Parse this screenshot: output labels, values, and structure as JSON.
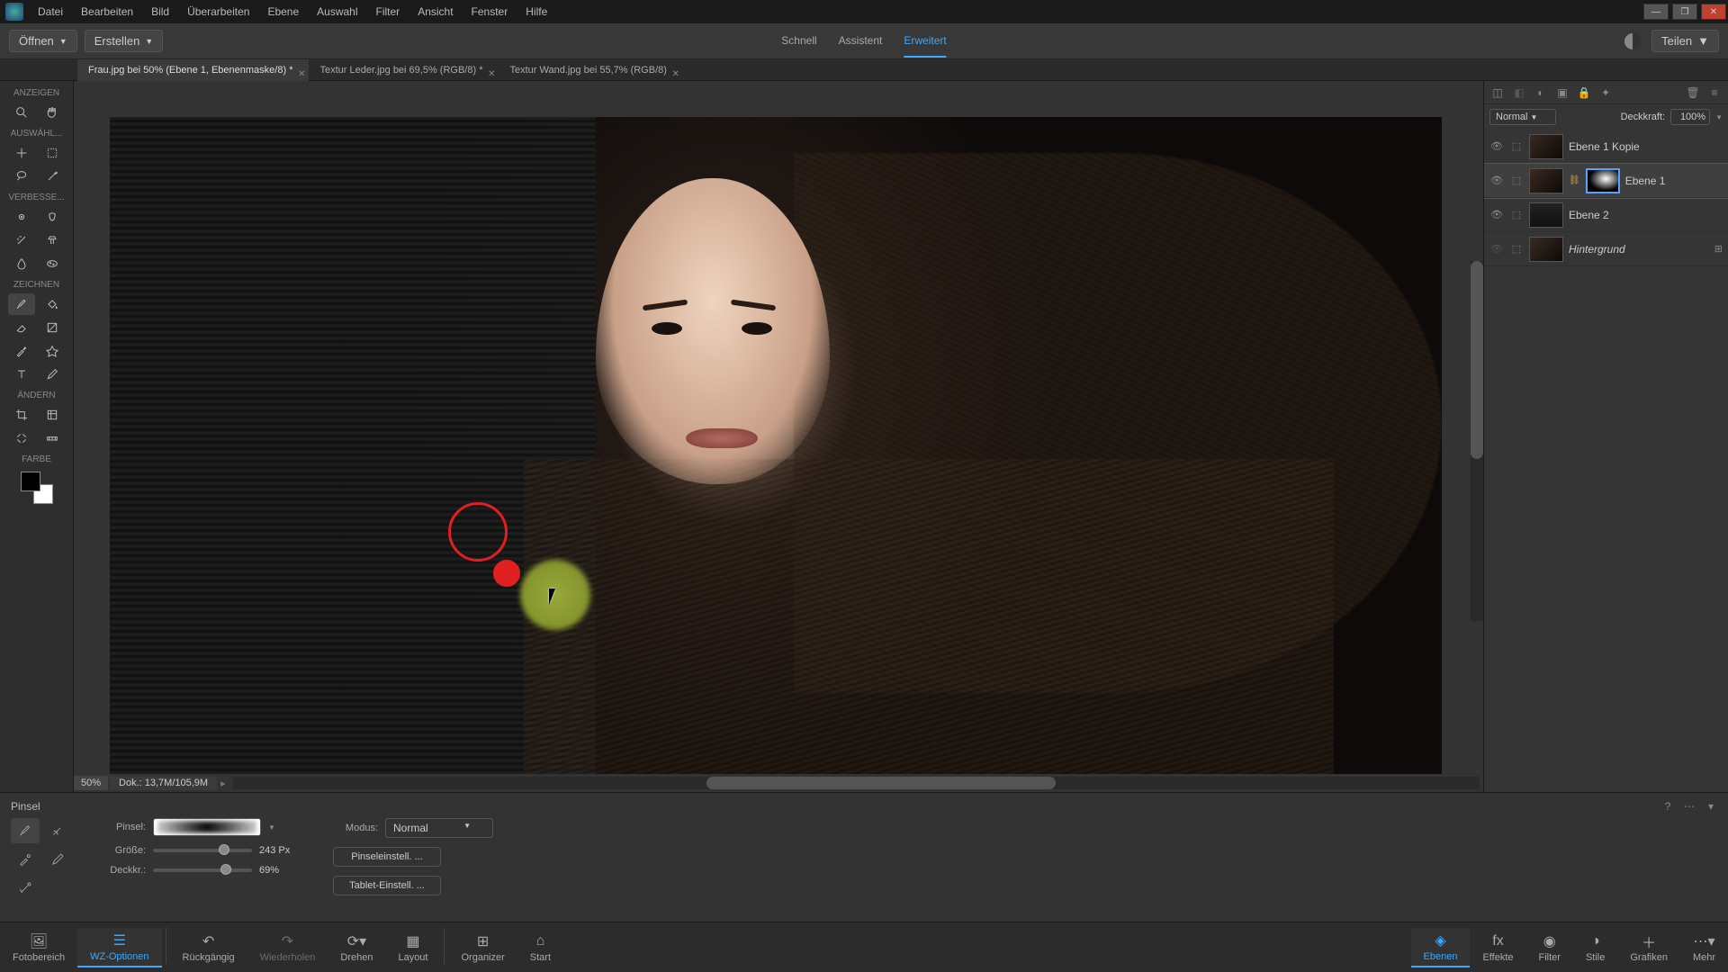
{
  "menu": {
    "datei": "Datei",
    "bearbeiten": "Bearbeiten",
    "bild": "Bild",
    "ueberarbeiten": "Überarbeiten",
    "ebene": "Ebene",
    "auswahl": "Auswahl",
    "filter": "Filter",
    "ansicht": "Ansicht",
    "fenster": "Fenster",
    "hilfe": "Hilfe"
  },
  "toolbar": {
    "open": "Öffnen",
    "create": "Erstellen",
    "share": "Teilen"
  },
  "modes": {
    "schnell": "Schnell",
    "assistent": "Assistent",
    "erweitert": "Erweitert"
  },
  "tabs": {
    "t1": "Frau.jpg bei 50% (Ebene 1, Ebenenmaske/8) *",
    "t2": "Textur Leder.jpg bei 69,5% (RGB/8) *",
    "t3": "Textur Wand.jpg bei 55,7% (RGB/8)"
  },
  "leftSections": {
    "anzeigen": "ANZEIGEN",
    "auswahl": "AUSWÄHL...",
    "verbessern": "VERBESSE...",
    "zeichnen": "ZEICHNEN",
    "aendern": "ÄNDERN",
    "farbe": "FARBE"
  },
  "canvas": {
    "zoom": "50%",
    "docsize": "Dok.: 13,7M/105,9M"
  },
  "layers": {
    "blendMode": "Normal",
    "opacityLabel": "Deckkraft:",
    "opacityValue": "100%",
    "items": [
      {
        "name": "Ebene 1 Kopie"
      },
      {
        "name": "Ebene 1"
      },
      {
        "name": "Ebene 2"
      },
      {
        "name": "Hintergrund"
      }
    ]
  },
  "toolopts": {
    "title": "Pinsel",
    "brushLabel": "Pinsel:",
    "sizeLabel": "Größe:",
    "sizeValue": "243 Px",
    "opacityLabel": "Deckkr.:",
    "opacityValue": "69%",
    "modeLabel": "Modus:",
    "modeValue": "Normal",
    "brushSettings": "Pinseleinstell. ...",
    "tabletSettings": "Tablet-Einstell. ..."
  },
  "bottombar": {
    "fotobereich": "Fotobereich",
    "wzoptionen": "WZ-Optionen",
    "rueckgaengig": "Rückgängig",
    "wiederholen": "Wiederholen",
    "drehen": "Drehen",
    "layout": "Layout",
    "organizer": "Organizer",
    "start": "Start",
    "ebenen": "Ebenen",
    "effekte": "Effekte",
    "filter": "Filter",
    "stile": "Stile",
    "grafiken": "Grafiken",
    "mehr": "Mehr"
  }
}
